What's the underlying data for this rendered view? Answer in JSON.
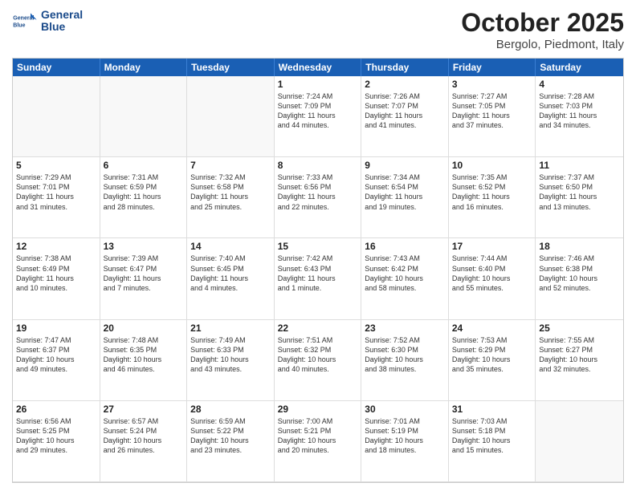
{
  "header": {
    "logo_line1": "General",
    "logo_line2": "Blue",
    "month": "October 2025",
    "location": "Bergolo, Piedmont, Italy"
  },
  "day_headers": [
    "Sunday",
    "Monday",
    "Tuesday",
    "Wednesday",
    "Thursday",
    "Friday",
    "Saturday"
  ],
  "weeks": [
    [
      {
        "day": "",
        "info": "",
        "empty": true
      },
      {
        "day": "",
        "info": "",
        "empty": true
      },
      {
        "day": "",
        "info": "",
        "empty": true
      },
      {
        "day": "1",
        "info": "Sunrise: 7:24 AM\nSunset: 7:09 PM\nDaylight: 11 hours\nand 44 minutes.",
        "empty": false
      },
      {
        "day": "2",
        "info": "Sunrise: 7:26 AM\nSunset: 7:07 PM\nDaylight: 11 hours\nand 41 minutes.",
        "empty": false
      },
      {
        "day": "3",
        "info": "Sunrise: 7:27 AM\nSunset: 7:05 PM\nDaylight: 11 hours\nand 37 minutes.",
        "empty": false
      },
      {
        "day": "4",
        "info": "Sunrise: 7:28 AM\nSunset: 7:03 PM\nDaylight: 11 hours\nand 34 minutes.",
        "empty": false
      }
    ],
    [
      {
        "day": "5",
        "info": "Sunrise: 7:29 AM\nSunset: 7:01 PM\nDaylight: 11 hours\nand 31 minutes.",
        "empty": false
      },
      {
        "day": "6",
        "info": "Sunrise: 7:31 AM\nSunset: 6:59 PM\nDaylight: 11 hours\nand 28 minutes.",
        "empty": false
      },
      {
        "day": "7",
        "info": "Sunrise: 7:32 AM\nSunset: 6:58 PM\nDaylight: 11 hours\nand 25 minutes.",
        "empty": false
      },
      {
        "day": "8",
        "info": "Sunrise: 7:33 AM\nSunset: 6:56 PM\nDaylight: 11 hours\nand 22 minutes.",
        "empty": false
      },
      {
        "day": "9",
        "info": "Sunrise: 7:34 AM\nSunset: 6:54 PM\nDaylight: 11 hours\nand 19 minutes.",
        "empty": false
      },
      {
        "day": "10",
        "info": "Sunrise: 7:35 AM\nSunset: 6:52 PM\nDaylight: 11 hours\nand 16 minutes.",
        "empty": false
      },
      {
        "day": "11",
        "info": "Sunrise: 7:37 AM\nSunset: 6:50 PM\nDaylight: 11 hours\nand 13 minutes.",
        "empty": false
      }
    ],
    [
      {
        "day": "12",
        "info": "Sunrise: 7:38 AM\nSunset: 6:49 PM\nDaylight: 11 hours\nand 10 minutes.",
        "empty": false
      },
      {
        "day": "13",
        "info": "Sunrise: 7:39 AM\nSunset: 6:47 PM\nDaylight: 11 hours\nand 7 minutes.",
        "empty": false
      },
      {
        "day": "14",
        "info": "Sunrise: 7:40 AM\nSunset: 6:45 PM\nDaylight: 11 hours\nand 4 minutes.",
        "empty": false
      },
      {
        "day": "15",
        "info": "Sunrise: 7:42 AM\nSunset: 6:43 PM\nDaylight: 11 hours\nand 1 minute.",
        "empty": false
      },
      {
        "day": "16",
        "info": "Sunrise: 7:43 AM\nSunset: 6:42 PM\nDaylight: 10 hours\nand 58 minutes.",
        "empty": false
      },
      {
        "day": "17",
        "info": "Sunrise: 7:44 AM\nSunset: 6:40 PM\nDaylight: 10 hours\nand 55 minutes.",
        "empty": false
      },
      {
        "day": "18",
        "info": "Sunrise: 7:46 AM\nSunset: 6:38 PM\nDaylight: 10 hours\nand 52 minutes.",
        "empty": false
      }
    ],
    [
      {
        "day": "19",
        "info": "Sunrise: 7:47 AM\nSunset: 6:37 PM\nDaylight: 10 hours\nand 49 minutes.",
        "empty": false
      },
      {
        "day": "20",
        "info": "Sunrise: 7:48 AM\nSunset: 6:35 PM\nDaylight: 10 hours\nand 46 minutes.",
        "empty": false
      },
      {
        "day": "21",
        "info": "Sunrise: 7:49 AM\nSunset: 6:33 PM\nDaylight: 10 hours\nand 43 minutes.",
        "empty": false
      },
      {
        "day": "22",
        "info": "Sunrise: 7:51 AM\nSunset: 6:32 PM\nDaylight: 10 hours\nand 40 minutes.",
        "empty": false
      },
      {
        "day": "23",
        "info": "Sunrise: 7:52 AM\nSunset: 6:30 PM\nDaylight: 10 hours\nand 38 minutes.",
        "empty": false
      },
      {
        "day": "24",
        "info": "Sunrise: 7:53 AM\nSunset: 6:29 PM\nDaylight: 10 hours\nand 35 minutes.",
        "empty": false
      },
      {
        "day": "25",
        "info": "Sunrise: 7:55 AM\nSunset: 6:27 PM\nDaylight: 10 hours\nand 32 minutes.",
        "empty": false
      }
    ],
    [
      {
        "day": "26",
        "info": "Sunrise: 6:56 AM\nSunset: 5:25 PM\nDaylight: 10 hours\nand 29 minutes.",
        "empty": false
      },
      {
        "day": "27",
        "info": "Sunrise: 6:57 AM\nSunset: 5:24 PM\nDaylight: 10 hours\nand 26 minutes.",
        "empty": false
      },
      {
        "day": "28",
        "info": "Sunrise: 6:59 AM\nSunset: 5:22 PM\nDaylight: 10 hours\nand 23 minutes.",
        "empty": false
      },
      {
        "day": "29",
        "info": "Sunrise: 7:00 AM\nSunset: 5:21 PM\nDaylight: 10 hours\nand 20 minutes.",
        "empty": false
      },
      {
        "day": "30",
        "info": "Sunrise: 7:01 AM\nSunset: 5:19 PM\nDaylight: 10 hours\nand 18 minutes.",
        "empty": false
      },
      {
        "day": "31",
        "info": "Sunrise: 7:03 AM\nSunset: 5:18 PM\nDaylight: 10 hours\nand 15 minutes.",
        "empty": false
      },
      {
        "day": "",
        "info": "",
        "empty": true
      }
    ]
  ]
}
